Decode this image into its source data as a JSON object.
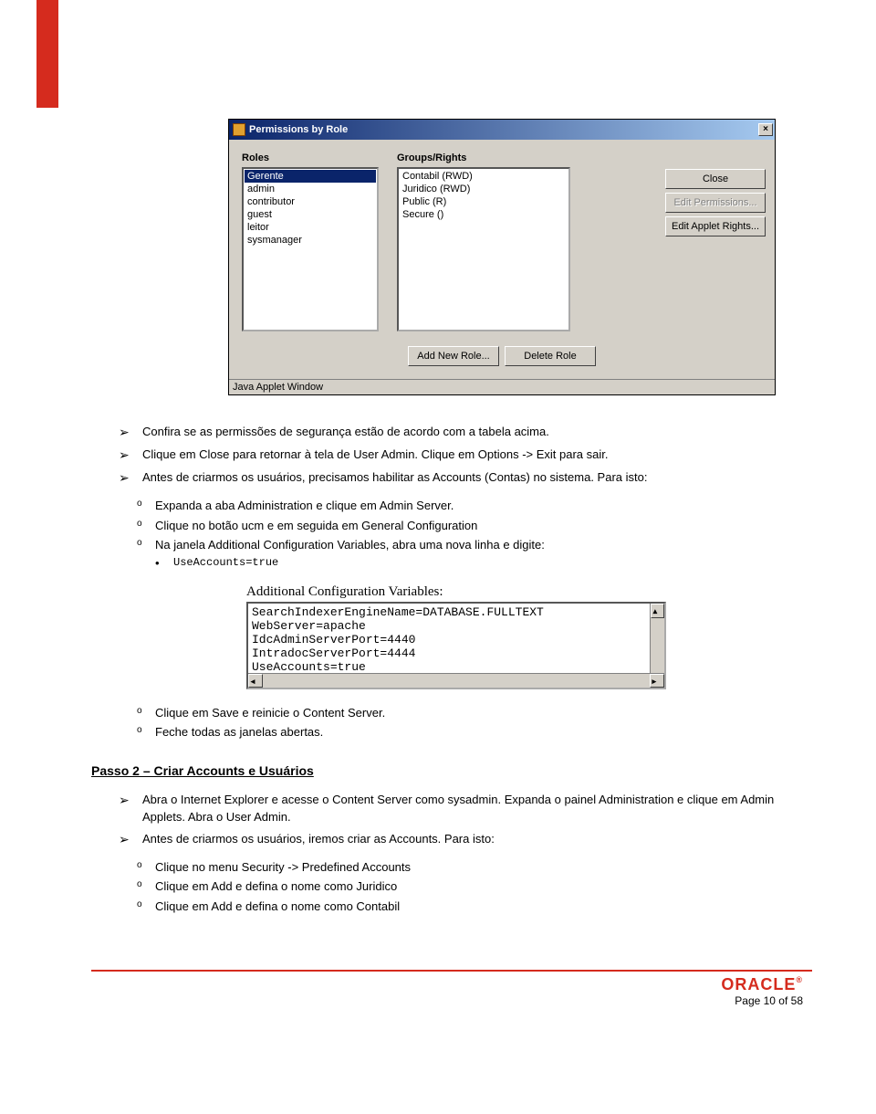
{
  "dialog": {
    "title": "Permissions by Role",
    "roles_label": "Roles",
    "groups_label": "Groups/Rights",
    "roles": [
      "Gerente",
      "admin",
      "contributor",
      "guest",
      "leitor",
      "sysmanager"
    ],
    "groups": [
      "Contabil (RWD)",
      "Juridico (RWD)",
      "Public (R)",
      "Secure ()"
    ],
    "btn_close": "Close",
    "btn_edit_perm": "Edit Permissions...",
    "btn_edit_applet": "Edit Applet Rights...",
    "btn_add_role": "Add New Role...",
    "btn_delete_role": "Delete Role",
    "status": "Java Applet Window"
  },
  "b1": "Confira se as permissões de segurança estão de acordo com a tabela acima.",
  "b2": "Clique em Close para retornar à tela de User Admin. Clique em Options -> Exit para sair.",
  "b3": "Antes de criarmos os usuários, precisamos habilitar as Accounts (Contas) no sistema. Para isto:",
  "s1": "Expanda a aba Administration e clique em Admin Server.",
  "s2": "Clique no botão ucm e em seguida em General Configuration",
  "s3": "Na janela Additional Configuration Variables, abra uma nova linha e digite:",
  "code1": "UseAccounts=true",
  "config": {
    "title": "Additional Configuration Variables:",
    "lines": [
      "SearchIndexerEngineName=DATABASE.FULLTEXT",
      "WebServer=apache",
      "IdcAdminServerPort=4440",
      "IntradocServerPort=4444",
      "UseAccounts=true"
    ]
  },
  "s4": "Clique em Save e reinicie o Content Server.",
  "s5": "Feche todas as janelas abertas.",
  "passo_title": "Passo 2 – Criar Accounts e Usuários",
  "p1": "Abra o Internet Explorer e acesse o Content Server como sysadmin. Expanda o painel Administration e clique em Admin Applets. Abra o User Admin.",
  "p2": "Antes de criarmos os usuários, iremos criar as Accounts. Para isto:",
  "ps1": "Clique no menu Security -> Predefined Accounts",
  "ps2": "Clique em Add e defina o nome como Juridico",
  "ps3": "Clique em Add e defina o nome como Contabil",
  "footer": {
    "logo": "ORACLE",
    "page": "Page 10 of 58"
  }
}
